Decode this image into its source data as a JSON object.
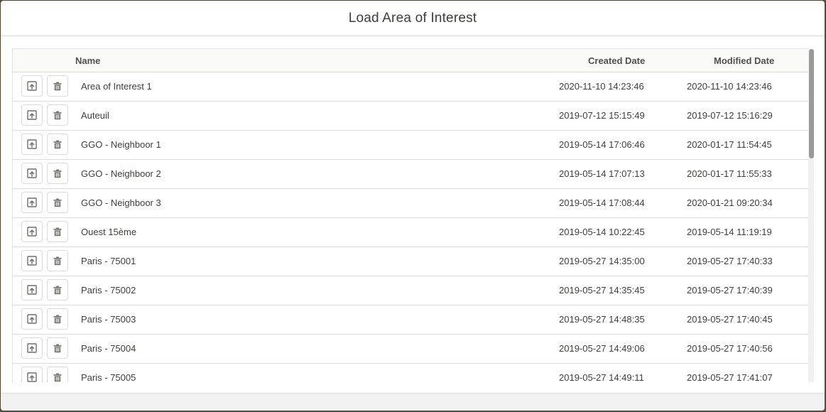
{
  "modal": {
    "title": "Load Area of Interest"
  },
  "table": {
    "columns": {
      "name": "Name",
      "created": "Created Date",
      "modified": "Modified Date"
    },
    "rows": [
      {
        "name": "Area of Interest 1",
        "created": "2020-11-10 14:23:46",
        "modified": "2020-11-10 14:23:46"
      },
      {
        "name": "Auteuil",
        "created": "2019-07-12 15:15:49",
        "modified": "2019-07-12 15:16:29"
      },
      {
        "name": "GGO - Neighboor 1",
        "created": "2019-05-14 17:06:46",
        "modified": "2020-01-17 11:54:45"
      },
      {
        "name": "GGO - Neighboor 2",
        "created": "2019-05-14 17:07:13",
        "modified": "2020-01-17 11:55:33"
      },
      {
        "name": "GGO - Neighboor 3",
        "created": "2019-05-14 17:08:44",
        "modified": "2020-01-21 09:20:34"
      },
      {
        "name": "Ouest 15ème",
        "created": "2019-05-14 10:22:45",
        "modified": "2019-05-14 11:19:19"
      },
      {
        "name": "Paris - 75001",
        "created": "2019-05-27 14:35:00",
        "modified": "2019-05-27 17:40:33"
      },
      {
        "name": "Paris - 75002",
        "created": "2019-05-27 14:35:45",
        "modified": "2019-05-27 17:40:39"
      },
      {
        "name": "Paris - 75003",
        "created": "2019-05-27 14:48:35",
        "modified": "2019-05-27 17:40:45"
      },
      {
        "name": "Paris - 75004",
        "created": "2019-05-27 14:49:06",
        "modified": "2019-05-27 17:40:56"
      },
      {
        "name": "Paris - 75005",
        "created": "2019-05-27 14:49:11",
        "modified": "2019-05-27 17:41:07"
      }
    ]
  },
  "icons": {
    "load": "upload-icon",
    "delete": "trash-icon"
  }
}
